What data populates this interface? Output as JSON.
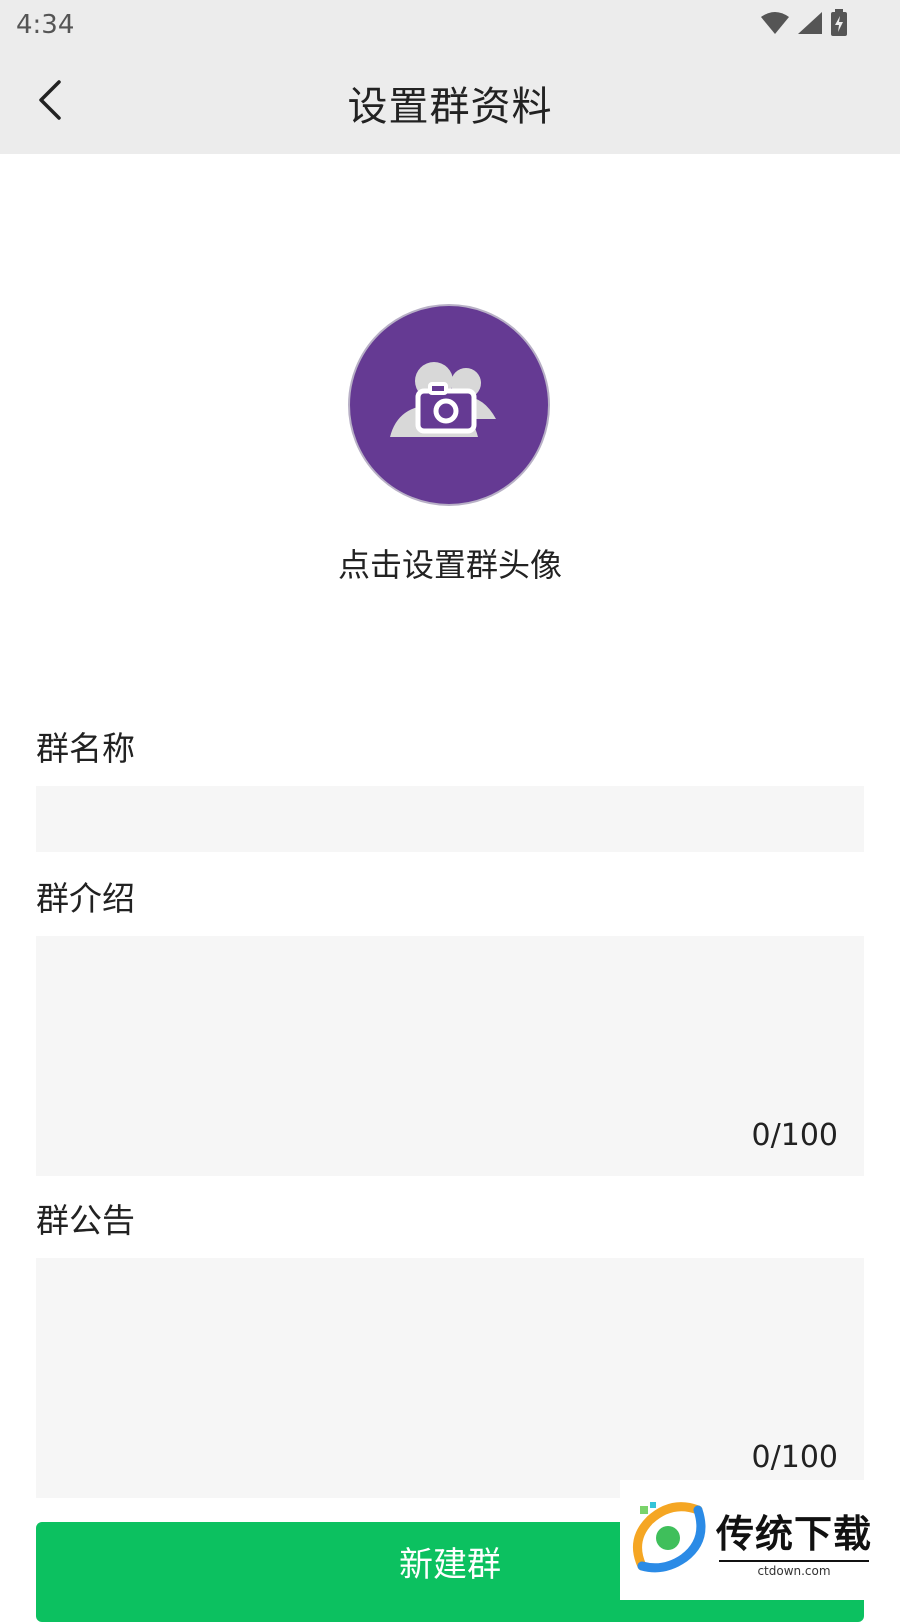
{
  "status_bar": {
    "time": "4:34"
  },
  "header": {
    "title": "设置群资料"
  },
  "avatar": {
    "caption": "点击设置群头像",
    "bg_color": "#653a93"
  },
  "form": {
    "name": {
      "label": "群名称",
      "value": ""
    },
    "intro": {
      "label": "群介绍",
      "value": "",
      "counter": "0/100"
    },
    "notice": {
      "label": "群公告",
      "value": "",
      "counter": "0/100"
    }
  },
  "create_button": {
    "label": "新建群",
    "color": "#0cc160"
  },
  "watermark": {
    "main": "传统下载",
    "sub": "ctdown.com"
  }
}
